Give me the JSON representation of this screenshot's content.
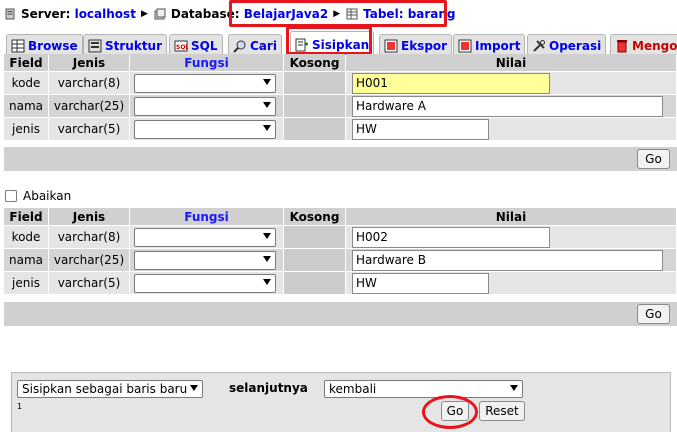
{
  "breadcrumb": {
    "server_label": "Server:",
    "server_value": "localhost",
    "database_label": "Database:",
    "database_value": "BelajarJava2",
    "table_label": "Tabel:",
    "table_value": "barang"
  },
  "tabs": [
    {
      "label": "Browse",
      "icon": "browse-icon"
    },
    {
      "label": "Struktur",
      "icon": "structure-icon"
    },
    {
      "label": "SQL",
      "icon": "sql-icon"
    },
    {
      "label": "Cari",
      "icon": "search-icon"
    },
    {
      "label": "Sisipkan",
      "icon": "insert-icon",
      "active": true
    },
    {
      "label": "Ekspor",
      "icon": "export-icon"
    },
    {
      "label": "Import",
      "icon": "import-icon"
    },
    {
      "label": "Operasi",
      "icon": "operations-icon"
    },
    {
      "label": "Mengosongkan",
      "icon": "empty-icon"
    }
  ],
  "columns": {
    "field": "Field",
    "jenis": "Jenis",
    "fungsi": "Fungsi",
    "kosong": "Kosong",
    "nilai": "Nilai"
  },
  "form1": {
    "rows": [
      {
        "field": "kode",
        "jenis": "varchar(8)",
        "fungsi": "",
        "value": "H001"
      },
      {
        "field": "nama",
        "jenis": "varchar(25)",
        "fungsi": "",
        "value": "Hardware A"
      },
      {
        "field": "jenis",
        "jenis": "varchar(5)",
        "fungsi": "",
        "value": "HW"
      }
    ],
    "go_label": "Go"
  },
  "ignore_label": "Abaikan",
  "form2": {
    "rows": [
      {
        "field": "kode",
        "jenis": "varchar(8)",
        "fungsi": "",
        "value": "H002"
      },
      {
        "field": "nama",
        "jenis": "varchar(25)",
        "fungsi": "",
        "value": "Hardware B"
      },
      {
        "field": "jenis",
        "jenis": "varchar(5)",
        "fungsi": "",
        "value": "HW"
      }
    ],
    "go_label": "Go"
  },
  "bottom": {
    "insert_mode": "Sisipkan sebagai baris baru",
    "next_label": "selanjutnya",
    "after_action": "kembali",
    "counter": "1",
    "go_label": "Go",
    "reset_label": "Reset"
  },
  "colors": {
    "link": "#0000ee",
    "highlight_box": "#e8141b",
    "header_bg": "#d0d0d0",
    "focused_input": "#ffff99"
  }
}
